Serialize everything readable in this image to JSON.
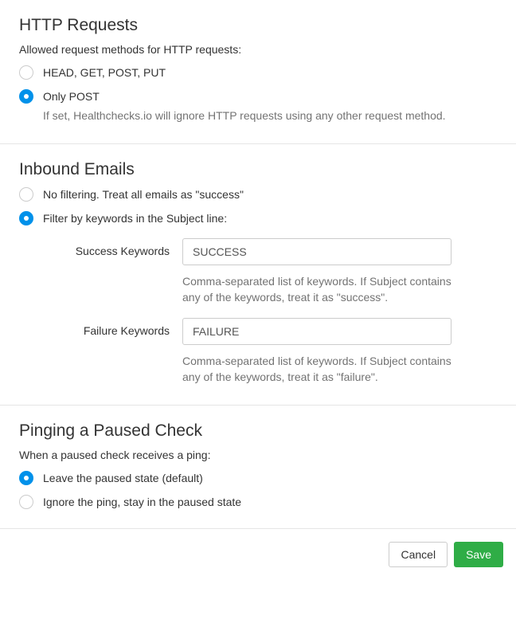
{
  "http": {
    "title": "HTTP Requests",
    "desc": "Allowed request methods for HTTP requests:",
    "options": [
      {
        "label": "HEAD, GET, POST, PUT",
        "selected": false
      },
      {
        "label": "Only POST",
        "selected": true,
        "help": "If set, Healthchecks.io will ignore HTTP requests using any other request method."
      }
    ]
  },
  "emails": {
    "title": "Inbound Emails",
    "options": [
      {
        "label": "No filtering. Treat all emails as \"success\"",
        "selected": false
      },
      {
        "label": "Filter by keywords in the Subject line:",
        "selected": true
      }
    ],
    "success": {
      "label": "Success Keywords",
      "value": "SUCCESS",
      "help": "Comma-separated list of keywords. If Subject contains any of the keywords, treat it as \"success\"."
    },
    "failure": {
      "label": "Failure Keywords",
      "value": "FAILURE",
      "help": "Comma-separated list of keywords. If Subject contains any of the keywords, treat it as \"failure\"."
    }
  },
  "paused": {
    "title": "Pinging a Paused Check",
    "desc": "When a paused check receives a ping:",
    "options": [
      {
        "label": "Leave the paused state (default)",
        "selected": true
      },
      {
        "label": "Ignore the ping, stay in the paused state",
        "selected": false
      }
    ]
  },
  "footer": {
    "cancel": "Cancel",
    "save": "Save"
  }
}
